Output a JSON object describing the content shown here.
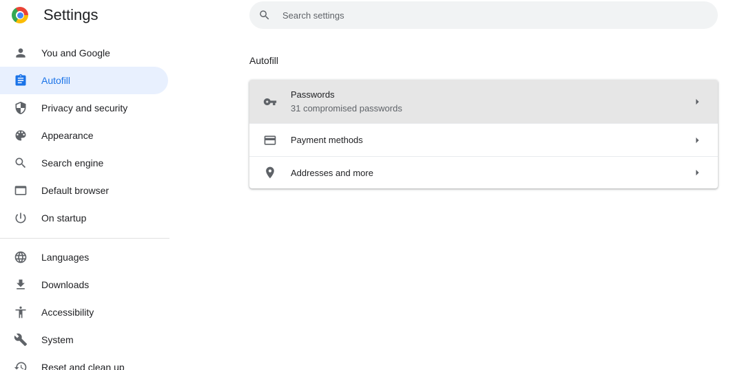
{
  "header": {
    "title": "Settings",
    "logo": "chrome-logo"
  },
  "search": {
    "placeholder": "Search settings",
    "value": "",
    "icon": "search-icon"
  },
  "sidebar": {
    "items": [
      {
        "label": "You and Google",
        "icon": "person-icon",
        "active": false
      },
      {
        "label": "Autofill",
        "icon": "clipboard-icon",
        "active": true
      },
      {
        "label": "Privacy and security",
        "icon": "shield-icon",
        "active": false
      },
      {
        "label": "Appearance",
        "icon": "palette-icon",
        "active": false
      },
      {
        "label": "Search engine",
        "icon": "search-icon",
        "active": false
      },
      {
        "label": "Default browser",
        "icon": "browser-window-icon",
        "active": false
      },
      {
        "label": "On startup",
        "icon": "power-icon",
        "active": false
      },
      {
        "label": "Languages",
        "icon": "globe-icon",
        "active": false
      },
      {
        "label": "Downloads",
        "icon": "download-icon",
        "active": false
      },
      {
        "label": "Accessibility",
        "icon": "accessibility-icon",
        "active": false
      },
      {
        "label": "System",
        "icon": "wrench-icon",
        "active": false
      },
      {
        "label": "Reset and clean up",
        "icon": "history-icon",
        "active": false
      }
    ]
  },
  "main": {
    "section_title": "Autofill",
    "rows": [
      {
        "label": "Passwords",
        "sublabel": "31 compromised passwords",
        "icon": "key-icon"
      },
      {
        "label": "Payment methods",
        "icon": "credit-card-icon"
      },
      {
        "label": "Addresses and more",
        "icon": "location-pin-icon"
      }
    ]
  },
  "colors": {
    "accent": "#1a73e8",
    "active_bg": "#e8f0fe",
    "icon": "#5f6368",
    "hover_row": "#e6e6e6"
  }
}
